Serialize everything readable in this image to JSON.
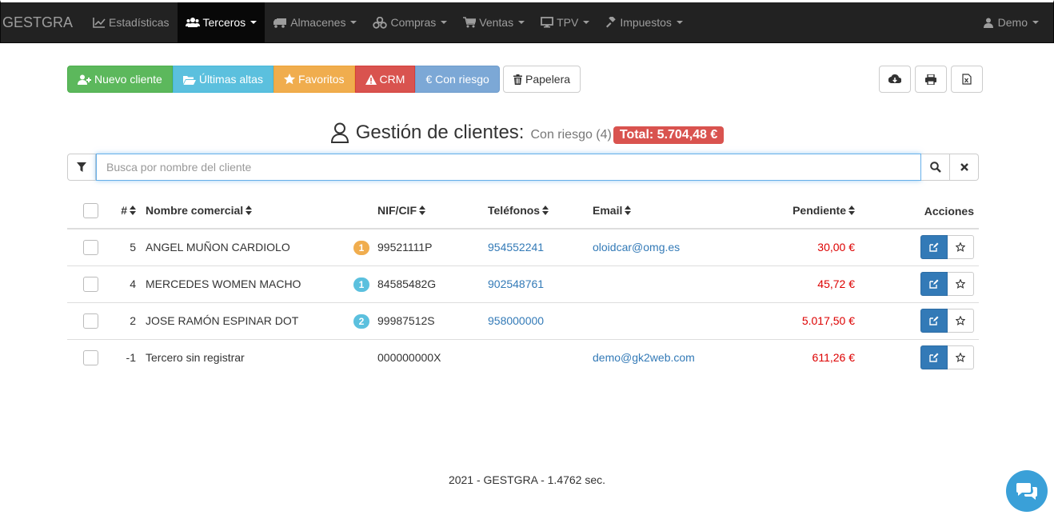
{
  "nav": {
    "brand": "GESTGRA",
    "items": [
      {
        "label": "Estadísticas",
        "icon": "chart-line-icon"
      },
      {
        "label": "Terceros",
        "icon": "users-icon"
      },
      {
        "label": "Almacenes",
        "icon": "truck-icon"
      },
      {
        "label": "Compras",
        "icon": "cubes-icon"
      },
      {
        "label": "Ventas",
        "icon": "shopping-cart-icon"
      },
      {
        "label": "TPV",
        "icon": "desktop-icon"
      },
      {
        "label": "Impuestos",
        "icon": "gavel-icon"
      }
    ],
    "user": "Demo"
  },
  "toolbar": {
    "new_client": "Nuevo cliente",
    "recent": "Últimas altas",
    "favorites": "Favoritos",
    "crm": "CRM",
    "at_risk": "€ Con riesgo",
    "trash": "Papelera"
  },
  "header": {
    "title": "Gestión de clientes:",
    "subtitle": "Con riesgo (4)",
    "total": "Total: 5.704,48 €"
  },
  "search": {
    "placeholder": "Busca por nombre del cliente"
  },
  "table": {
    "columns": {
      "num": "#",
      "name": "Nombre comercial",
      "nif": "NIF/CIF",
      "phones": "Teléfonos",
      "email": "Email",
      "pending": "Pendiente",
      "actions": "Acciones"
    },
    "rows": [
      {
        "num": "5",
        "name": "ANGEL MUÑON CARDIOLO",
        "badge": "1",
        "nif": "99521111P",
        "phone": "954552241",
        "email": "oloidcar@omg.es",
        "pending": "30,00 €"
      },
      {
        "num": "4",
        "name": "MERCEDES WOMEN MACHO",
        "badge": "1",
        "nif": "84585482G",
        "phone": "902548761",
        "email": "",
        "pending": "45,72 €"
      },
      {
        "num": "2",
        "name": "JOSE RAMÓN ESPINAR DOT",
        "badge": "2",
        "nif": "99987512S",
        "phone": "958000000",
        "email": "",
        "pending": "5.017,50 €"
      },
      {
        "num": "-1",
        "name": "Tercero sin registrar",
        "badge": "",
        "nif": "000000000X",
        "phone": "",
        "email": "demo@gk2web.com",
        "pending": "611,26 €"
      }
    ]
  },
  "footer": "2021 - GESTGRA - 1.4762 sec.",
  "colors": {
    "navbar": "#222222",
    "success": "#5cb85c",
    "info": "#5bc0de",
    "warning": "#f0ad4e",
    "danger": "#d9534f",
    "primary": "#337ab7",
    "pending_text": "#dd0000"
  }
}
